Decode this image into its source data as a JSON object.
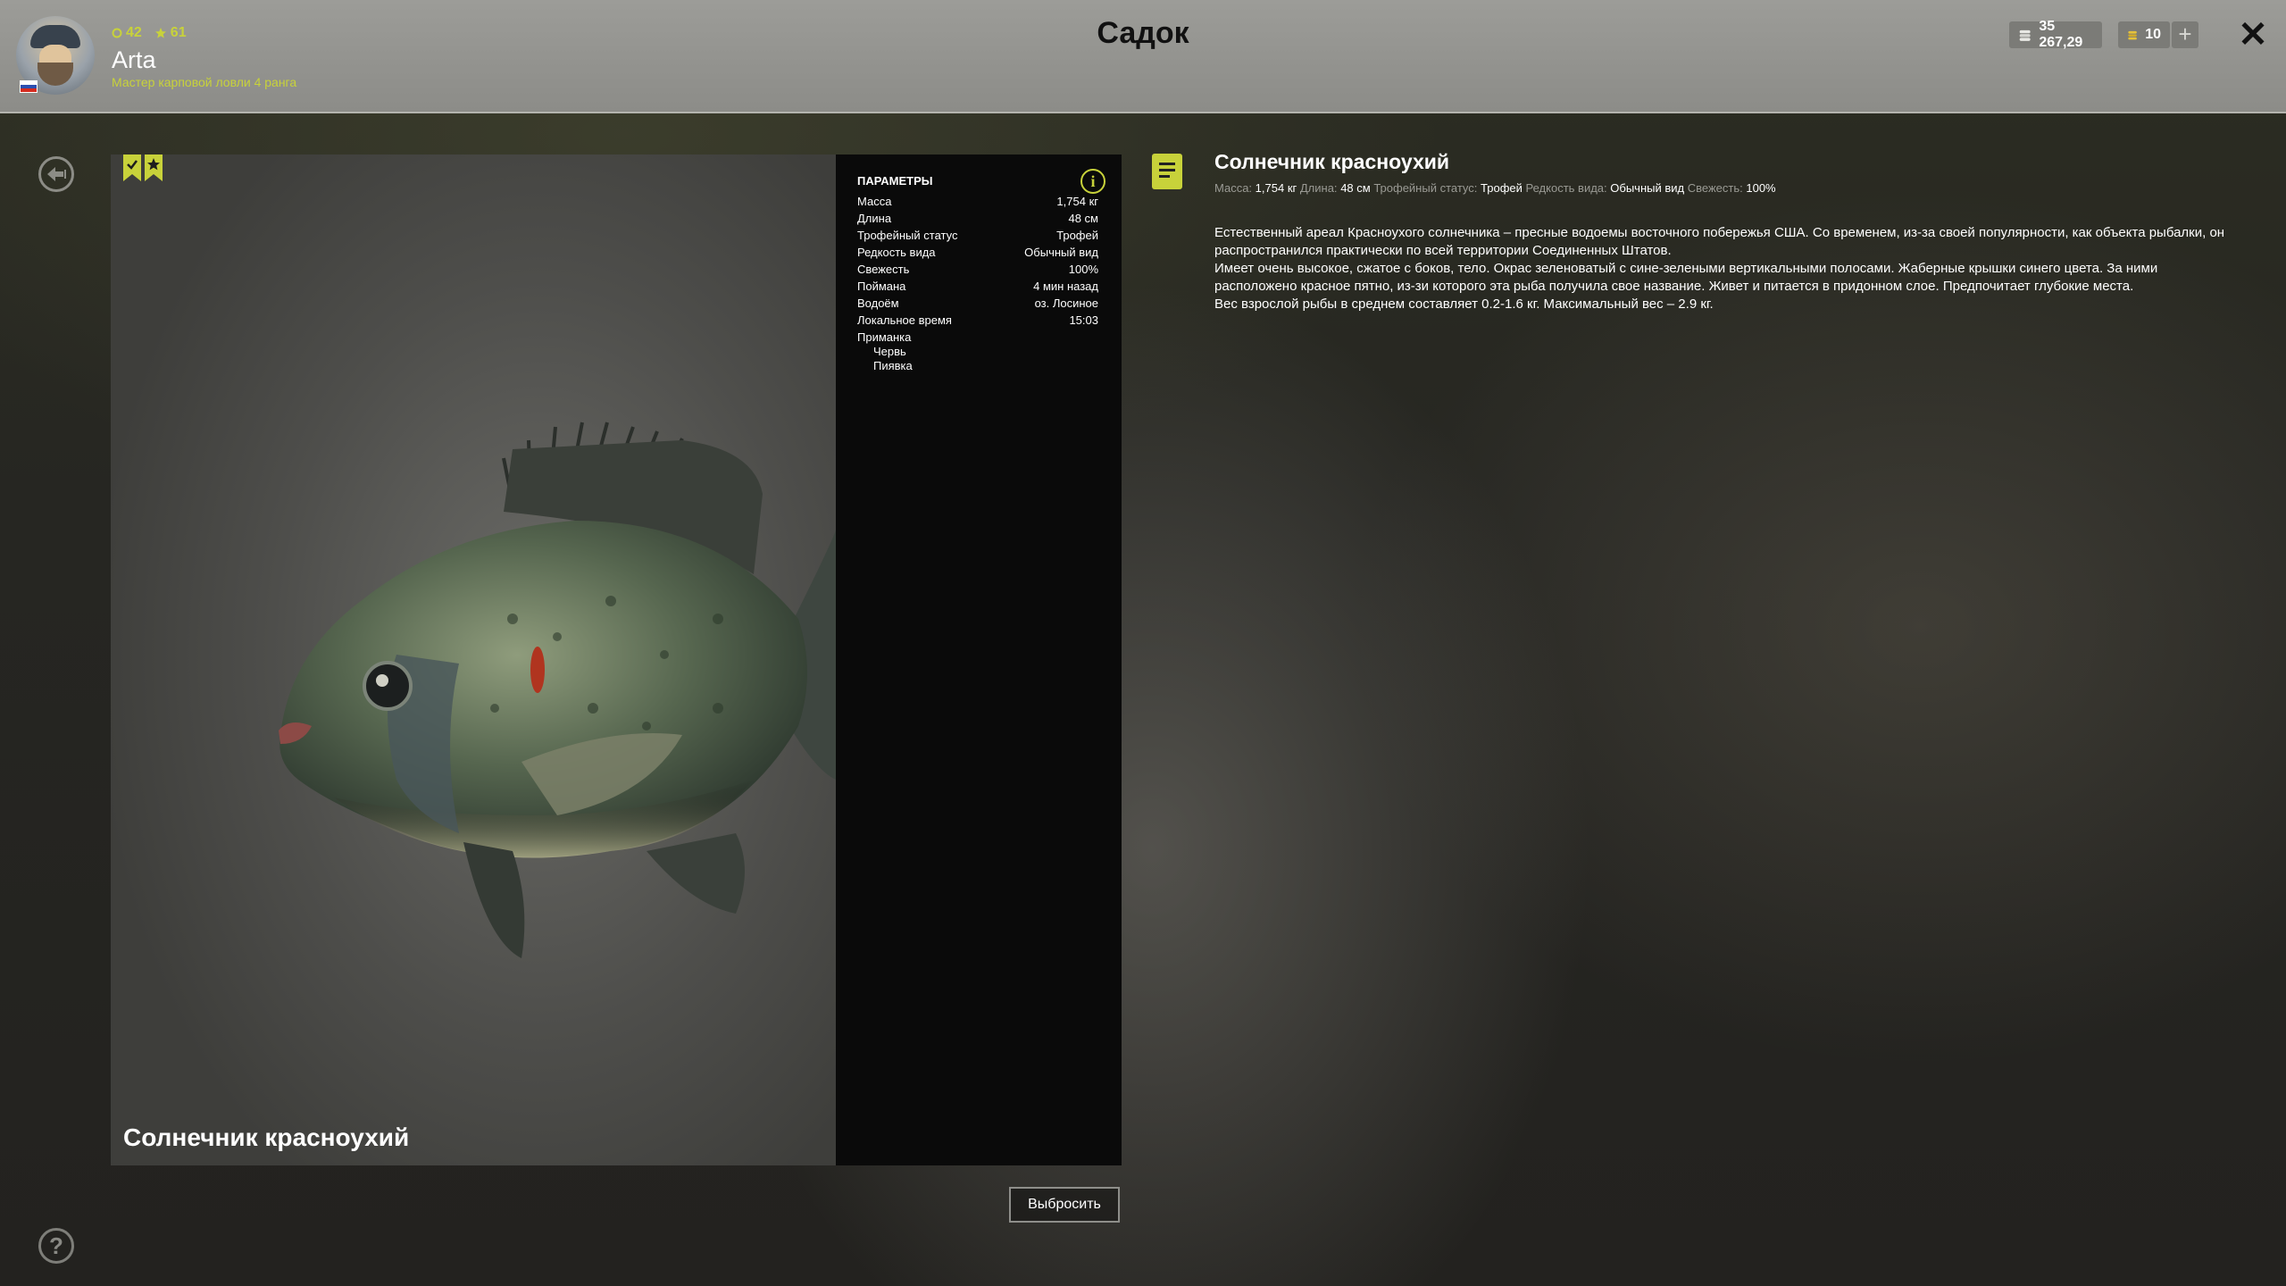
{
  "header": {
    "title": "Садок",
    "player": {
      "name": "Arta",
      "rank": "Мастер карповой ловли 4 ранга",
      "level": "42",
      "stars": "61"
    },
    "money": "35 267,29",
    "gold": "10",
    "plus_label": "+",
    "close_label": "✕"
  },
  "card": {
    "fish_name": "Солнечник красноухий",
    "params_title": "ПАРАМЕТРЫ",
    "params": [
      {
        "label": "Масса",
        "value": "1,754 кг"
      },
      {
        "label": "Длина",
        "value": "48 см"
      },
      {
        "label": "Трофейный статус",
        "value": "Трофей"
      },
      {
        "label": "Редкость вида",
        "value": "Обычный вид"
      },
      {
        "label": "Свежесть",
        "value": "100%"
      },
      {
        "label": "Поймана",
        "value": "4 мин назад"
      },
      {
        "label": "Водоём",
        "value": "оз. Лосиное"
      },
      {
        "label": "Локальное время",
        "value": "15:03"
      }
    ],
    "bait_label": "Приманка",
    "baits": [
      "Червь",
      "Пиявка"
    ],
    "discard_label": "Выбросить"
  },
  "description": {
    "title": "Солнечник красноухий",
    "meta": {
      "mass_label": "Масса:",
      "mass": "1,754 кг",
      "length_label": "Длина:",
      "length": "48 см",
      "trophy_label": "Трофейный статус:",
      "trophy": "Трофей",
      "rarity_label": "Редкость вида:",
      "rarity": "Обычный вид",
      "fresh_label": "Свежесть:",
      "fresh": "100%"
    },
    "lines": [
      "Естественный ареал Красноухого солнечника – пресные водоемы восточного побережья США. Со временем, из-за своей популярности, как объекта рыбалки, он распространился практически по всей территории Соединенных Штатов.",
      "Имеет очень высокое, сжатое с боков, тело. Окрас зеленоватый с сине-зелеными вертикальными полосами. Жаберные крышки синего цвета. За ними расположено красное пятно, из-зи которого эта рыба получила свое название. Живет и питается в придонном слое. Предпочитает глубокие места.",
      "Вес взрослой рыбы в среднем составляет 0.2-1.6 кг. Максимальный вес – 2.9 кг."
    ]
  },
  "help_label": "?",
  "colors": {
    "accent": "#c8d23a",
    "header": "#959591",
    "panel": "#0a0a0a"
  }
}
